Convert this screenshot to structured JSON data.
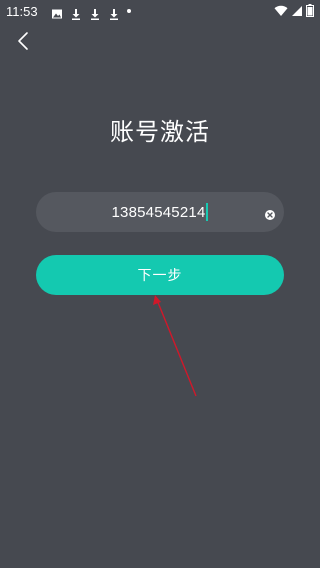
{
  "status_bar": {
    "time": "11:53",
    "left_icons": [
      "image-icon",
      "download-icon",
      "download-icon",
      "download-icon",
      "dot-icon"
    ],
    "right_icons": [
      "wifi-icon",
      "signal-icon",
      "battery-icon"
    ]
  },
  "header": {
    "back_icon": "chevron-left-icon",
    "title": "账号激活"
  },
  "form": {
    "phone_value": "13854545214",
    "clear_icon": "clear-circle-icon",
    "next_label": "下一步"
  },
  "colors": {
    "background": "#464950",
    "input_background": "#55585f",
    "accent": "#14c9b0",
    "annotation": "#d0182a"
  }
}
